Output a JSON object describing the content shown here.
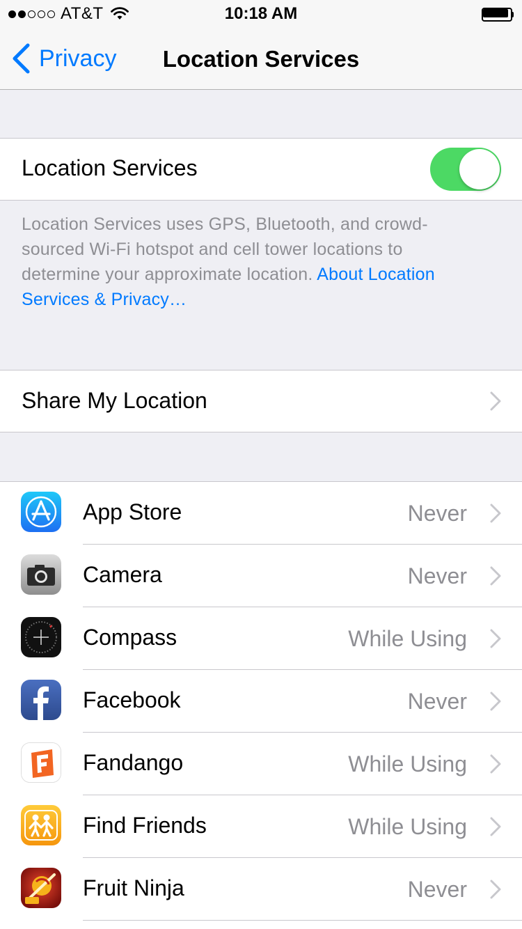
{
  "status_bar": {
    "carrier": "AT&T",
    "time": "10:18 AM",
    "signal_bars_filled": 2,
    "signal_bars_total": 5
  },
  "nav": {
    "back_label": "Privacy",
    "title": "Location Services"
  },
  "location_toggle": {
    "label": "Location Services",
    "on": true
  },
  "footer": {
    "description": "Location Services uses GPS, Bluetooth, and crowd-sourced Wi-Fi hotspot and cell tower locations to determine your approximate location. ",
    "link": "About Location Services & Privacy…"
  },
  "share_my_location": {
    "label": "Share My Location"
  },
  "apps": [
    {
      "name": "App Store",
      "value": "Never",
      "icon": "app-store-icon"
    },
    {
      "name": "Camera",
      "value": "Never",
      "icon": "camera-icon"
    },
    {
      "name": "Compass",
      "value": "While Using",
      "icon": "compass-icon"
    },
    {
      "name": "Facebook",
      "value": "Never",
      "icon": "facebook-icon"
    },
    {
      "name": "Fandango",
      "value": "While Using",
      "icon": "fandango-icon"
    },
    {
      "name": "Find Friends",
      "value": "While Using",
      "icon": "find-friends-icon"
    },
    {
      "name": "Fruit Ninja",
      "value": "Never",
      "icon": "fruit-ninja-icon"
    }
  ],
  "colors": {
    "accent": "#007aff",
    "toggle_on": "#4cd964",
    "secondary_text": "#8e8e93",
    "group_background": "#efeff4"
  }
}
